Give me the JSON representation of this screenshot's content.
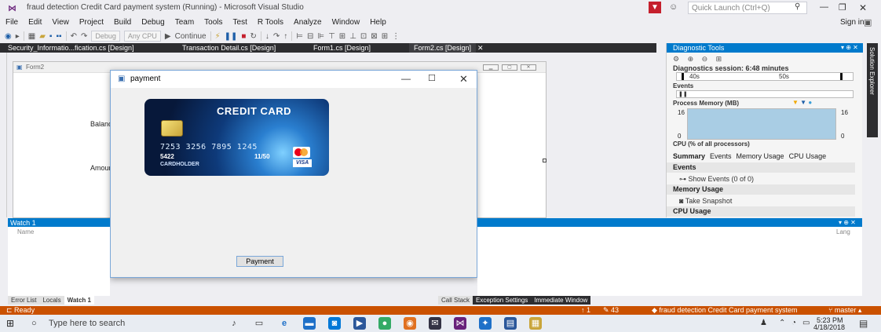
{
  "titlebar": {
    "title": "fraud detection Credit Card payment system (Running) - Microsoft Visual Studio",
    "quick_launch_placeholder": "Quick Launch (Ctrl+Q)"
  },
  "menu": {
    "items": [
      "File",
      "Edit",
      "View",
      "Project",
      "Build",
      "Debug",
      "Team",
      "Tools",
      "Test",
      "R Tools",
      "Analyze",
      "Window",
      "Help"
    ],
    "signin": "Sign in"
  },
  "toolbar": {
    "config": "Debug",
    "platform": "Any CPU",
    "continue": "Continue"
  },
  "doc_tabs": [
    "Security_Informatio...fication.cs [Design]",
    "Transaction Detail.cs [Design]",
    "Form1.cs [Design]",
    "Form2.cs [Design]"
  ],
  "form2": {
    "title": "Form2",
    "balance_label": "Balanc",
    "amount_label": "Amoun"
  },
  "payment_dialog": {
    "title": "payment",
    "button": "Payment",
    "card": {
      "title": "CREDIT CARD",
      "number": "7253 3256 7895 1245",
      "prefix": "5422",
      "expiry": "11/50",
      "expiry_label": "VALID THRU",
      "holder": "CARDHOLDER",
      "brand_visa": "VISA"
    }
  },
  "diagnostics": {
    "title": "Diagnostic Tools",
    "session": "Diagnostics session: 6:48 minutes",
    "tick_40": "40s",
    "tick_50": "50s",
    "events": "Events",
    "process_memory": "Process Memory (MB)",
    "mem_max": "16",
    "mem_min": "0",
    "cpu": "CPU (% of all processors)",
    "tabs": [
      "Summary",
      "Events",
      "Memory Usage",
      "CPU Usage"
    ],
    "events_section": "Events",
    "show_events": "Show Events (0 of 0)",
    "memory_section": "Memory Usage",
    "take_snapshot": "Take Snapshot",
    "cpu_section": "CPU Usage"
  },
  "solution_explorer": "Solution Explorer",
  "watch": {
    "title": "Watch 1",
    "col_name": "Name",
    "col_lang": "Lang"
  },
  "bottom_tabs_left": [
    "Error List",
    "Locals",
    "Watch 1"
  ],
  "bottom_tabs_right": [
    "Call Stack",
    "Exception Settings",
    "Immediate Window"
  ],
  "status": {
    "ready": "Ready",
    "up": "1",
    "edits": "43",
    "project": "fraud detection Credit Card payment system",
    "branch": "master"
  },
  "taskbar": {
    "search_placeholder": "Type here to search",
    "time": "5:23 PM",
    "date": "4/18/2018"
  },
  "colors": {
    "vs_blue": "#007acc",
    "status_orange": "#ca5100",
    "dark_tab": "#2d2d30"
  }
}
